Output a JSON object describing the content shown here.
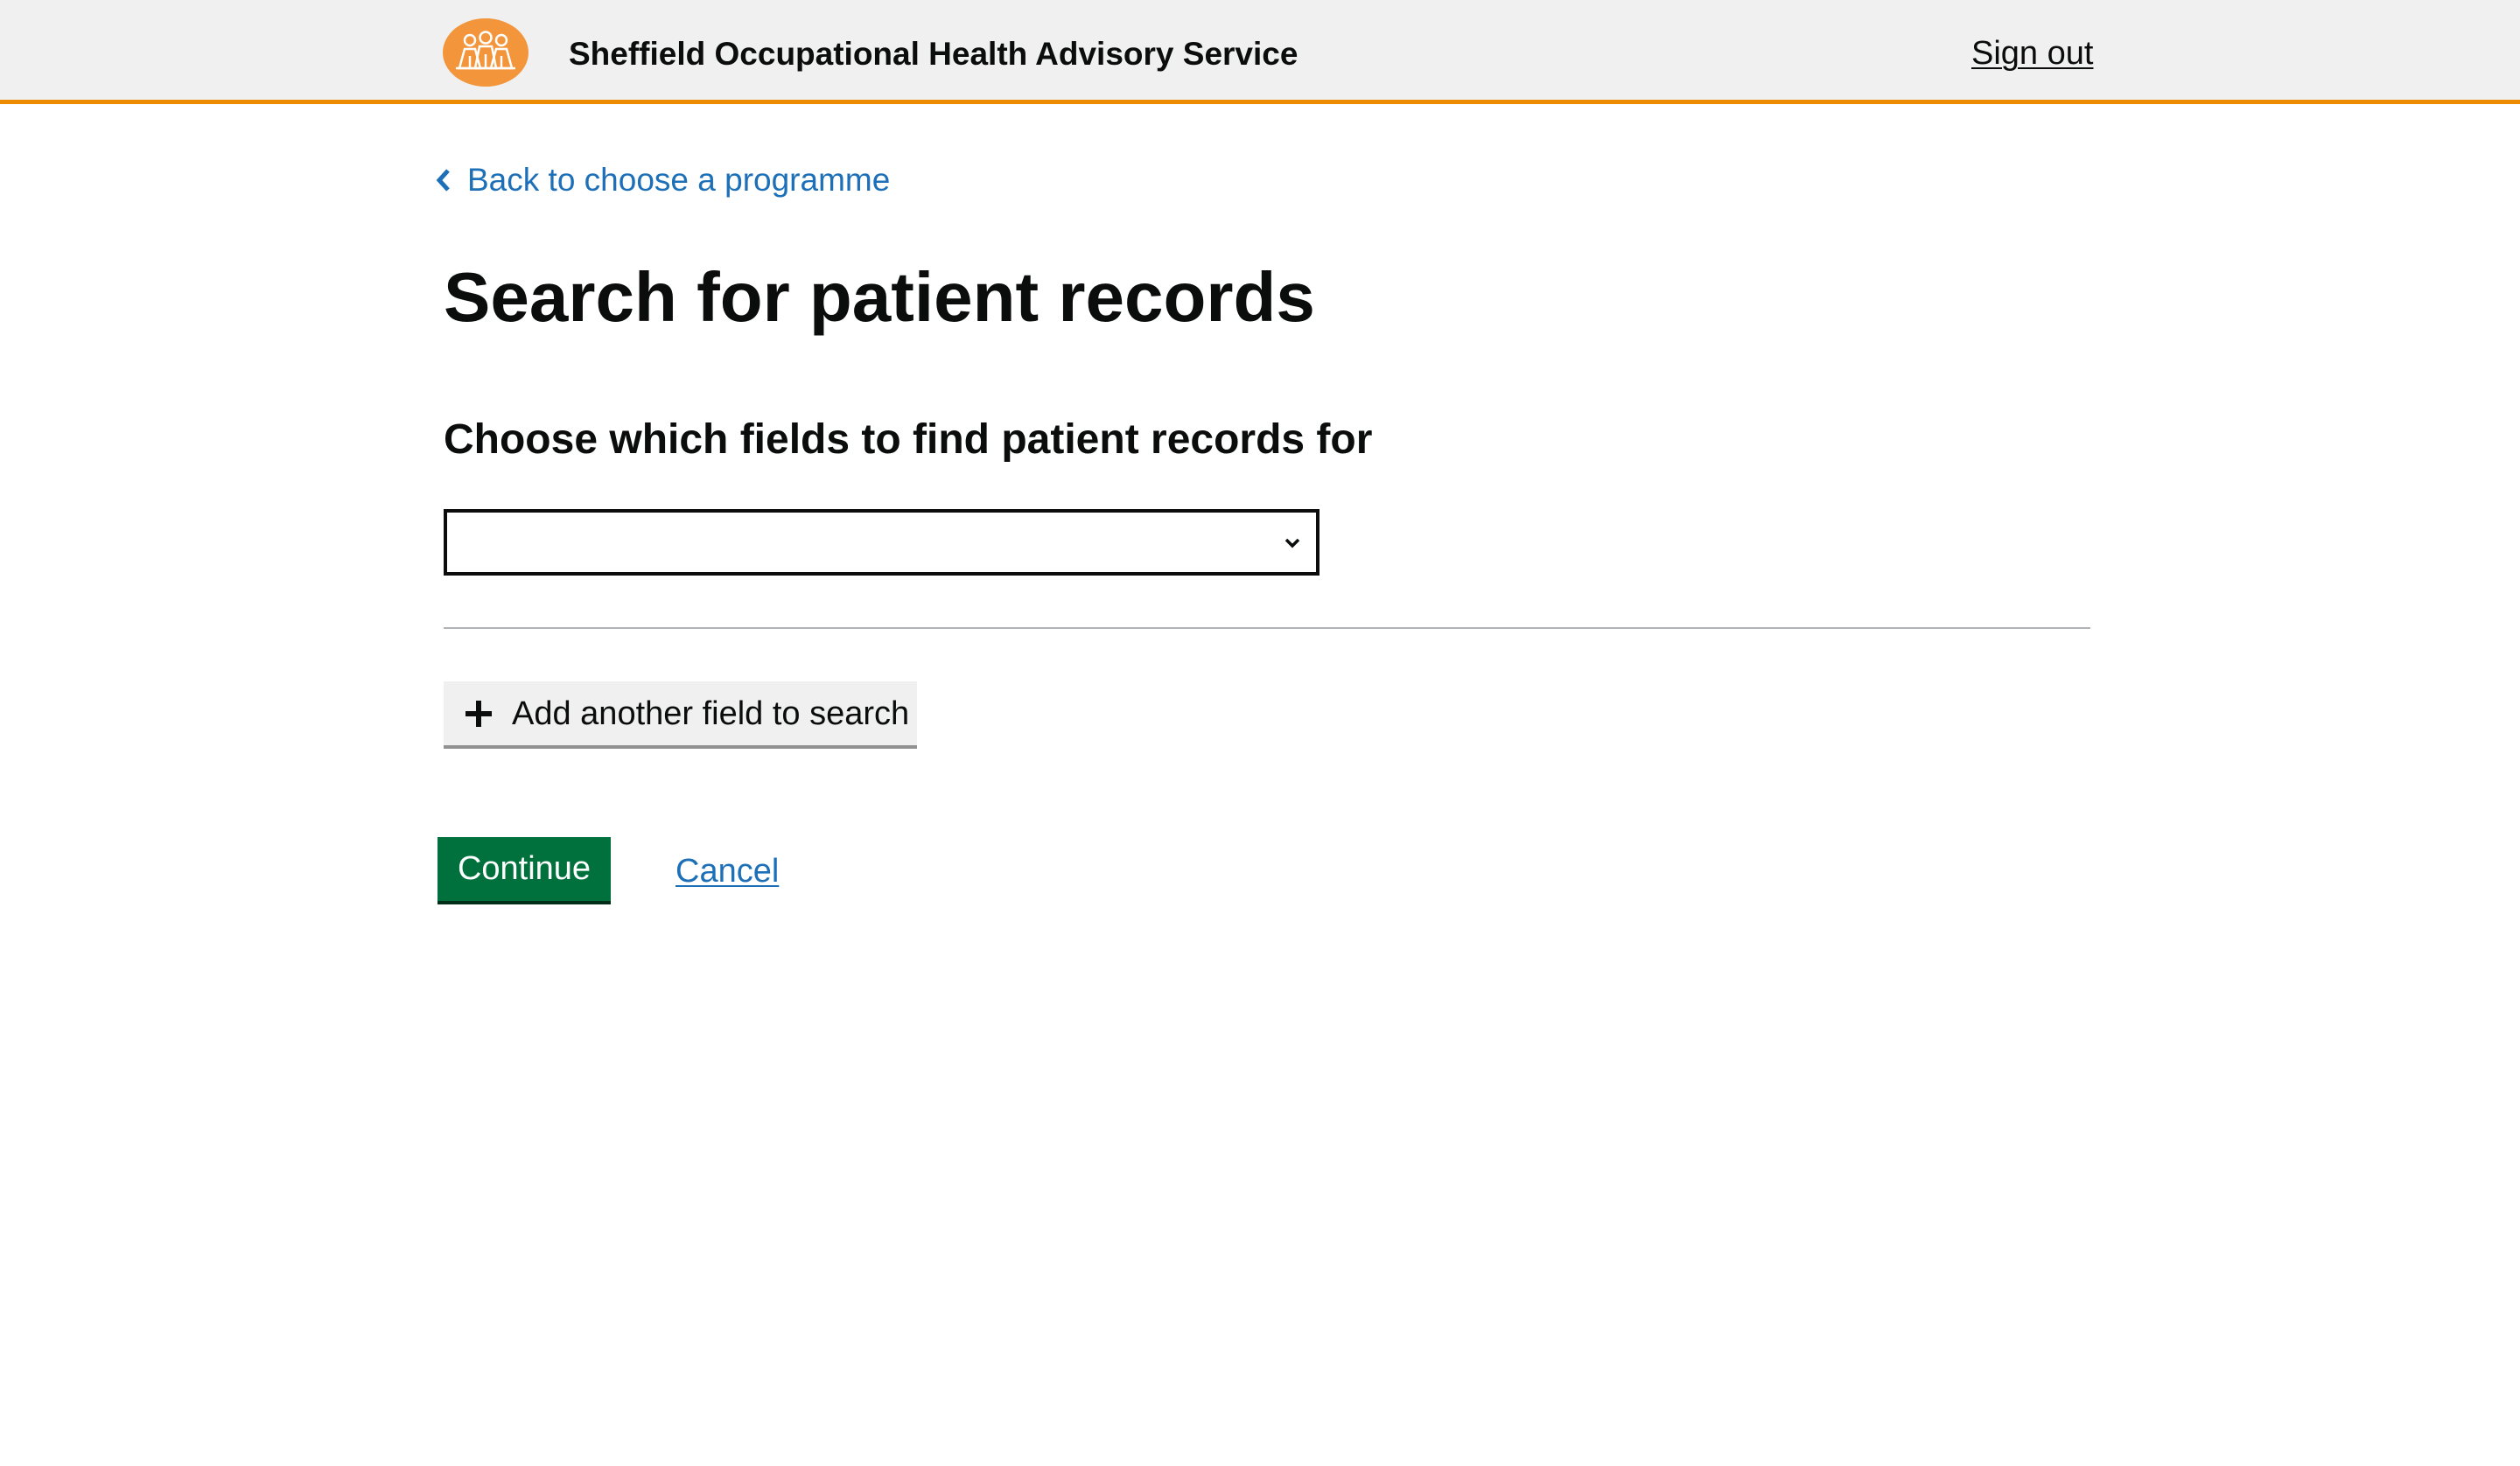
{
  "header": {
    "logo_icon": "people-group-icon",
    "service_name": "Sheffield Occupational Health Advisory Service",
    "sign_out_label": "Sign out"
  },
  "nav": {
    "back_label": "Back to choose a programme",
    "back_icon": "chevron-left-icon"
  },
  "main": {
    "title": "Search for patient records",
    "field_label": "Choose which fields to find patient records for",
    "field_select": {
      "selected_value": "",
      "icon": "chevron-down-icon"
    },
    "add_field_button": {
      "icon": "plus-icon",
      "label": "Add another field to search"
    },
    "continue_label": "Continue",
    "cancel_label": "Cancel"
  },
  "colors": {
    "accent_orange": "#ed8b00",
    "logo_orange": "#f3953b",
    "link_blue": "#1d70b8",
    "primary_green": "#00703c",
    "header_bg": "#f0f0f0",
    "text": "#0b0c0c"
  }
}
